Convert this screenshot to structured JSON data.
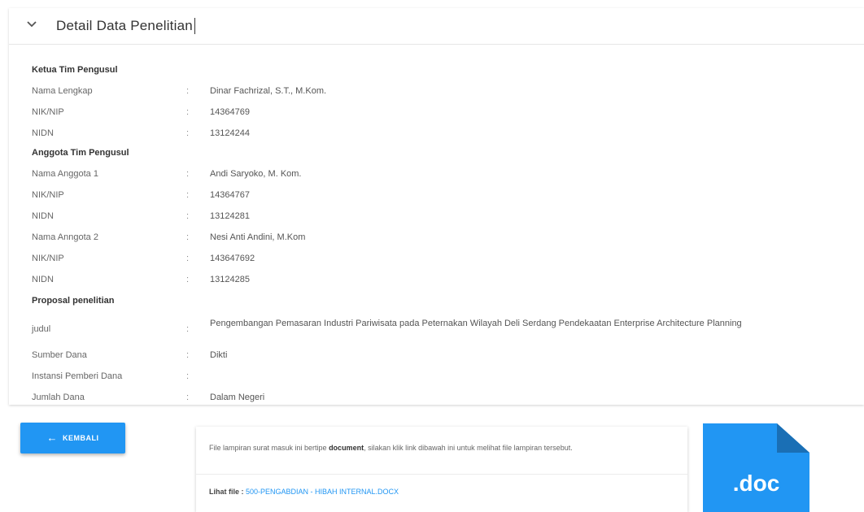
{
  "panel": {
    "title": "Detail Data Penelitian"
  },
  "ketua": {
    "heading": "Ketua Tim Pengusul",
    "rows": [
      {
        "label": "Nama Lengkap",
        "colon": ":",
        "value": "Dinar Fachrizal, S.T., M.Kom."
      },
      {
        "label": "NIK/NIP",
        "colon": ":",
        "value": "14364769"
      },
      {
        "label": "NIDN",
        "colon": ":",
        "value": "13124244"
      }
    ]
  },
  "anggota": {
    "heading": "Anggota Tim Pengusul",
    "rows": [
      {
        "label": "Nama Anggota 1",
        "colon": ":",
        "value": "Andi Saryoko, M. Kom."
      },
      {
        "label": "NIK/NIP",
        "colon": ":",
        "value": "14364767"
      },
      {
        "label": "NIDN",
        "colon": ":",
        "value": "13124281"
      },
      {
        "label": "Nama Anngota 2",
        "colon": ":",
        "value": "Nesi Anti Andini, M.Kom"
      },
      {
        "label": "NIK/NIP",
        "colon": ":",
        "value": "143647692"
      },
      {
        "label": "NIDN",
        "colon": ":",
        "value": "13124285"
      }
    ]
  },
  "proposal": {
    "heading": "Proposal penelitian",
    "rows": [
      {
        "label": "judul",
        "colon": ":",
        "value": "Pengembangan Pemasaran Industri Pariwisata pada Peternakan Wilayah Deli Serdang Pendekaatan Enterprise Architecture Planning"
      },
      {
        "label": "Sumber Dana",
        "colon": ":",
        "value": "Dikti"
      },
      {
        "label": "Instansi Pemberi Dana",
        "colon": ":",
        "value": ""
      },
      {
        "label": "Jumlah Dana",
        "colon": ":",
        "value": "Dalam Negeri"
      }
    ]
  },
  "back_button": {
    "arrow": "←",
    "label": "KEMBALI"
  },
  "file_card": {
    "desc_pre": "File lampiran surat masuk ini bertipe ",
    "desc_type": "document",
    "desc_post": ", silakan klik link dibawah ini untuk melihat file lampiran tersebut.",
    "link_lead": "Lihat file : ",
    "link_text": "500-PENGABDIAN - HIBAH INTERNAL.DOCX"
  },
  "doc_icon": {
    "ext": ".doc",
    "color": "#2196f3",
    "fold_color": "#1a6fb5"
  },
  "colors": {
    "accent": "#2196f3"
  }
}
